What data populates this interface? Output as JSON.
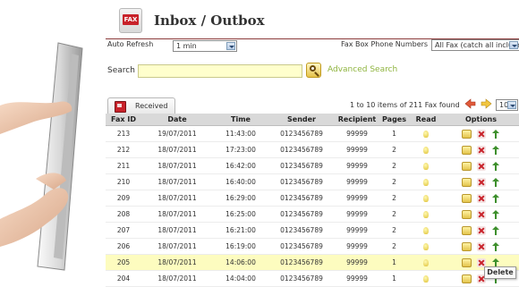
{
  "header": {
    "title": "Inbox / Outbox",
    "app_icon_label": "FAX"
  },
  "toolbar": {
    "auto_refresh_label": "Auto Refresh",
    "auto_refresh_value": "1 min",
    "fax_box_label": "Fax Box Phone Numbers",
    "fax_box_value": "All Fax (catch all included)"
  },
  "search": {
    "label": "Search",
    "value": "",
    "advanced_link": "Advanced Search"
  },
  "tab": {
    "label": "Received"
  },
  "pager": {
    "info": "1 to 10 items of 211 Fax found",
    "page_size": "10"
  },
  "table": {
    "columns": [
      "Fax ID",
      "Date",
      "Time",
      "Sender",
      "Recipient",
      "Pages",
      "Read",
      "Options"
    ],
    "rows": [
      {
        "id": "213",
        "date": "19/07/2011",
        "time": "11:43:00",
        "sender": "0123456789",
        "recipient": "99999",
        "pages": "1"
      },
      {
        "id": "212",
        "date": "18/07/2011",
        "time": "17:23:00",
        "sender": "0123456789",
        "recipient": "99999",
        "pages": "2"
      },
      {
        "id": "211",
        "date": "18/07/2011",
        "time": "16:42:00",
        "sender": "0123456789",
        "recipient": "99999",
        "pages": "2"
      },
      {
        "id": "210",
        "date": "18/07/2011",
        "time": "16:40:00",
        "sender": "0123456789",
        "recipient": "99999",
        "pages": "2"
      },
      {
        "id": "209",
        "date": "18/07/2011",
        "time": "16:29:00",
        "sender": "0123456789",
        "recipient": "99999",
        "pages": "2"
      },
      {
        "id": "208",
        "date": "18/07/2011",
        "time": "16:25:00",
        "sender": "0123456789",
        "recipient": "99999",
        "pages": "2"
      },
      {
        "id": "207",
        "date": "18/07/2011",
        "time": "16:21:00",
        "sender": "0123456789",
        "recipient": "99999",
        "pages": "2"
      },
      {
        "id": "206",
        "date": "18/07/2011",
        "time": "16:19:00",
        "sender": "0123456789",
        "recipient": "99999",
        "pages": "2"
      },
      {
        "id": "205",
        "date": "18/07/2011",
        "time": "14:06:00",
        "sender": "0123456789",
        "recipient": "99999",
        "pages": "1",
        "highlight": true
      },
      {
        "id": "204",
        "date": "18/07/2011",
        "time": "14:04:00",
        "sender": "0123456789",
        "recipient": "99999",
        "pages": "1"
      }
    ]
  },
  "tooltip": {
    "text": "Delete"
  },
  "icons": {
    "read": "lightbulb-icon",
    "forward": "forward-envelope-icon",
    "delete": "delete-icon",
    "download": "download-arrow-icon",
    "prev_page": "prev-page-icon",
    "next_page": "next-page-icon",
    "search": "search-icon"
  },
  "colors": {
    "accent_rule": "#8b3a3a",
    "link": "#8fb43f",
    "highlight_row": "#fdfcbf",
    "search_field": "#ffffcc",
    "fax_red": "#c8222a"
  }
}
